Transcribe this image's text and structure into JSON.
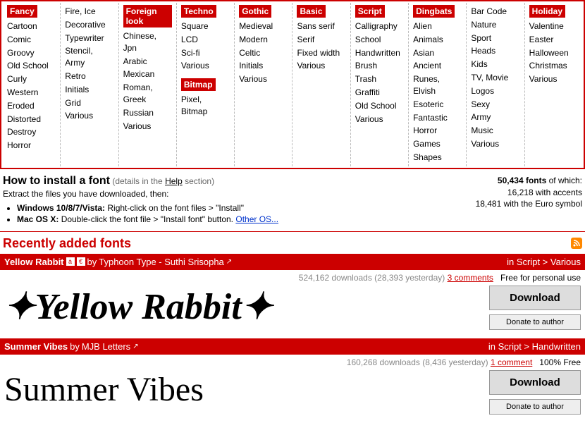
{
  "categories": [
    {
      "header": "Fancy",
      "items": [
        "Cartoon",
        "Comic",
        "Groovy",
        "Old School",
        "Curly",
        "Western",
        "Eroded",
        "Distorted",
        "Destroy",
        "Horror"
      ]
    },
    {
      "header": null,
      "items": [
        "Fire, Ice",
        "Decorative",
        "Typewriter",
        "Stencil, Army",
        "Retro",
        "Initials",
        "Grid",
        "Various"
      ]
    },
    {
      "header": "Foreign look",
      "items": [
        "Chinese, Jpn",
        "Arabic",
        "Mexican",
        "Roman, Greek",
        "Russian",
        "Various"
      ]
    },
    {
      "header": "Techno",
      "items": [
        "Square",
        "LCD",
        "Sci-fi",
        "Various"
      ],
      "subheader": "Bitmap",
      "subitems": [
        "Pixel, Bitmap"
      ]
    },
    {
      "header": "Gothic",
      "items": [
        "Medieval",
        "Modern",
        "Celtic",
        "Initials",
        "Various"
      ]
    },
    {
      "header": "Basic",
      "items": [
        "Sans serif",
        "Serif",
        "Fixed width",
        "Various"
      ]
    },
    {
      "header": "Script",
      "items": [
        "Calligraphy",
        "School",
        "Handwritten",
        "Brush",
        "Trash",
        "Graffiti",
        "Old School",
        "Various"
      ]
    },
    {
      "header": "Dingbats",
      "items": [
        "Alien",
        "Animals",
        "Asian",
        "Ancient",
        "Runes, Elvish",
        "Esoteric",
        "Fantastic",
        "Horror",
        "Games",
        "Shapes"
      ]
    },
    {
      "header": null,
      "items": [
        "Bar Code",
        "Nature",
        "Sport",
        "Heads",
        "Kids",
        "TV, Movie",
        "Logos",
        "Sexy",
        "Army",
        "Music",
        "Various"
      ]
    },
    {
      "header": "Holiday",
      "items": [
        "Valentine",
        "Easter",
        "Halloween",
        "Christmas",
        "Various"
      ]
    }
  ],
  "install": {
    "title": "How to install a font",
    "details_prefix": "(details in the ",
    "details_link": "Help",
    "details_suffix": " section)",
    "extract": "Extract the files you have downloaded, then:",
    "win_label": "Windows 10/8/7/Vista:",
    "win_text": " Right-click on the font files > \"Install\"",
    "mac_label": "Mac OS X:",
    "mac_text": " Double-click the font file > \"Install font\" button. ",
    "other_os": "Other OS..."
  },
  "stats": {
    "line1a": "50,434 fonts",
    "line1b": " of which:",
    "line2": "16,218 with accents",
    "line3": "18,481 with the Euro symbol"
  },
  "recent_title": "Recently added fonts",
  "fonts": [
    {
      "name": "Yellow Rabbit",
      "by": "by",
      "author": "Typhoon Type - Suthi Srisopha",
      "category": "in Script > Various",
      "downloads": "524,162 downloads (28,393 yesterday)   ",
      "comments": "3 comments",
      "license": "Free for personal use",
      "preview": "✦Yellow Rabbit✦",
      "download": "Download",
      "donate": "Donate to author"
    },
    {
      "name": "Summer Vibes",
      "by": "by",
      "author": "MJB Letters",
      "category": "in Script > Handwritten",
      "downloads": "160,268 downloads (8,436 yesterday)   ",
      "comments": "1 comment",
      "license": "100% Free",
      "preview": "Summer Vibes",
      "download": "Download",
      "donate": "Donate to author"
    }
  ]
}
